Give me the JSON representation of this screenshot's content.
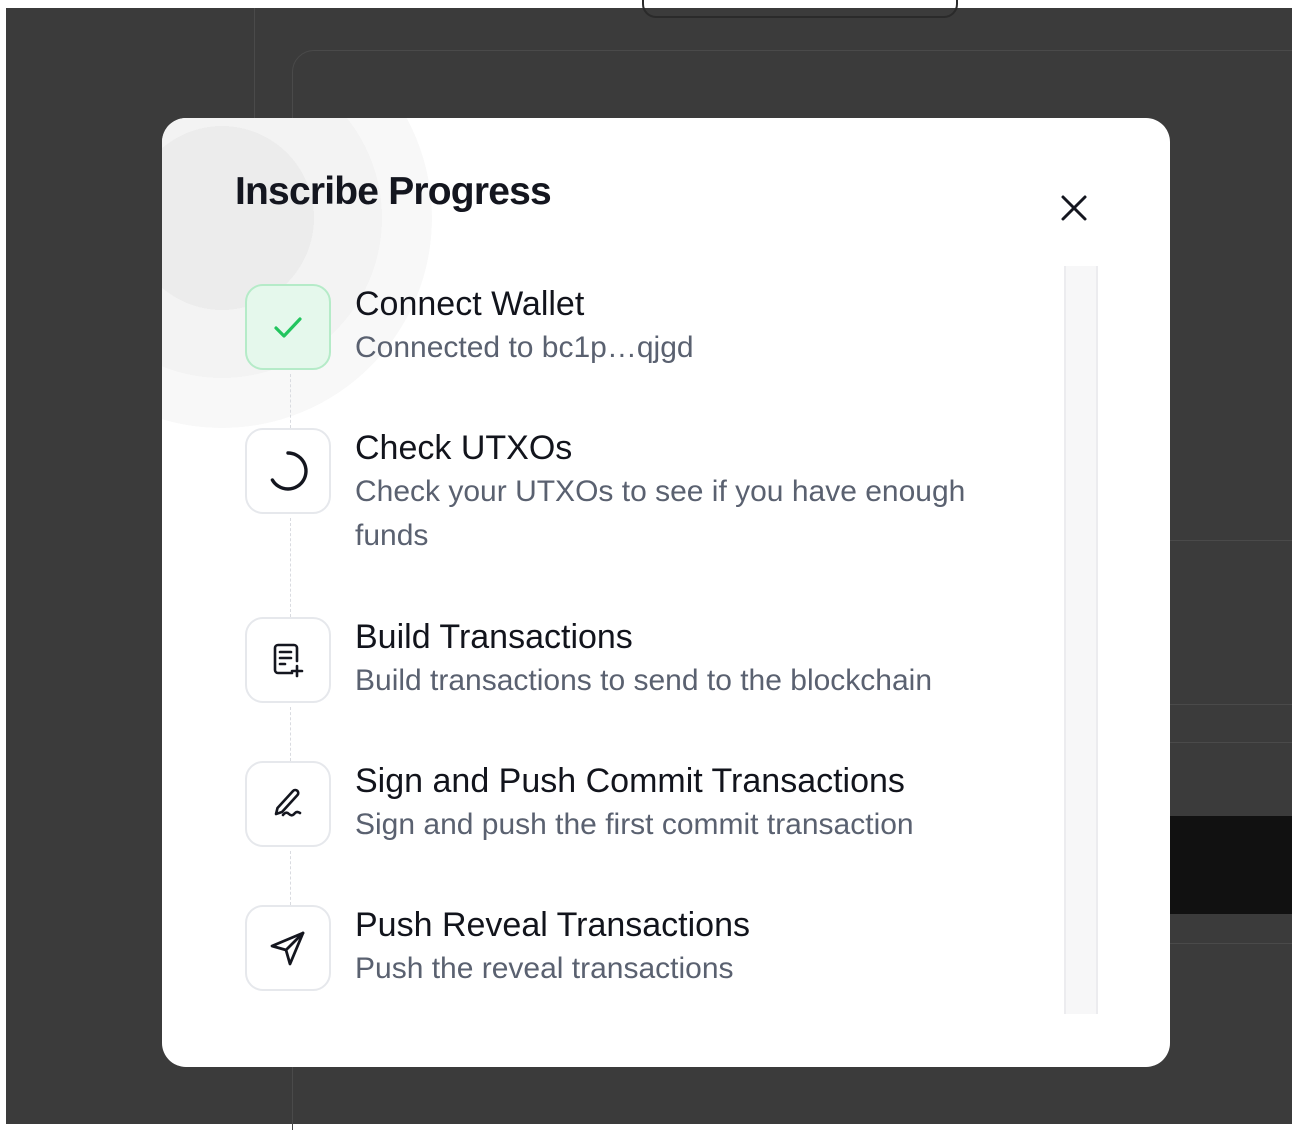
{
  "modal": {
    "title": "Inscribe Progress",
    "close_icon": "close-icon"
  },
  "steps": [
    {
      "title": "Connect Wallet",
      "description": "Connected to bc1p…qjgd",
      "icon": "check-icon",
      "status": "complete"
    },
    {
      "title": "Check UTXOs",
      "description": "Check your UTXOs to see if you have enough funds",
      "icon": "spinner-icon",
      "status": "in-progress"
    },
    {
      "title": "Build Transactions",
      "description": "Build transactions to send to the blockchain",
      "icon": "document-plus-icon",
      "status": "pending"
    },
    {
      "title": "Sign and Push Commit Transactions",
      "description": "Sign and push the first commit transaction",
      "icon": "signature-pen-icon",
      "status": "pending"
    },
    {
      "title": "Push Reveal Transactions",
      "description": "Push the reveal transactions",
      "icon": "send-icon",
      "status": "pending"
    }
  ],
  "colors": {
    "success_green": "#22c55e",
    "success_bg": "#e5f8ec",
    "overlay": "#3b3b3b",
    "text_primary": "#12141c",
    "text_secondary": "#5a6170"
  }
}
